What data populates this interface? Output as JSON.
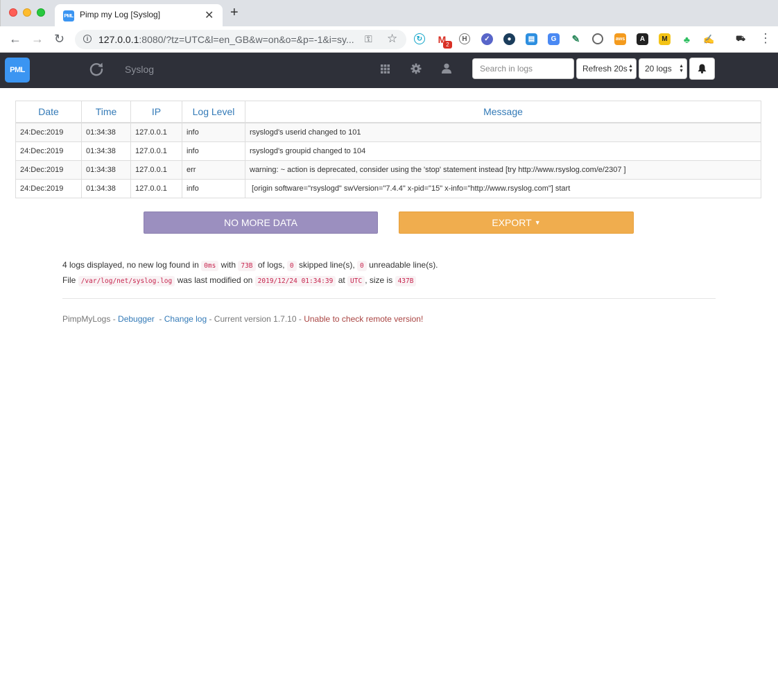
{
  "browser": {
    "tab_title": "Pimp my Log [Syslog]",
    "favicon_text": "PML",
    "url_host": "127.0.0.1",
    "url_rest": ":8080/?tz=UTC&l=en_GB&w=on&o=&p=-1&i=sy...",
    "extension_badge": "2",
    "icons": [
      "back-icon",
      "forward-icon",
      "reload-icon",
      "info-icon",
      "key-icon",
      "star-icon",
      "menu-icon"
    ]
  },
  "navbar": {
    "logo_text": "PML",
    "title": "Syslog",
    "search_placeholder": "Search in logs",
    "refresh_label": "Refresh 20s",
    "logs_count_label": "20 logs",
    "bg_color": "#2e3039"
  },
  "table": {
    "headers": [
      "Date",
      "Time",
      "IP",
      "Log Level",
      "Message"
    ],
    "rows": [
      [
        "24:Dec:2019",
        "01:34:38",
        "127.0.0.1",
        "info",
        "rsyslogd's userid changed to 101"
      ],
      [
        "24:Dec:2019",
        "01:34:38",
        "127.0.0.1",
        "info",
        "rsyslogd's groupid changed to 104"
      ],
      [
        "24:Dec:2019",
        "01:34:38",
        "127.0.0.1",
        "err",
        "warning: ~ action is deprecated, consider using the 'stop' statement instead [try http://www.rsyslog.com/e/2307 ]"
      ],
      [
        "24:Dec:2019",
        "01:34:38",
        "127.0.0.1",
        "info",
        " [origin software=\"rsyslogd\" swVersion=\"7.4.4\" x-pid=\"15\" x-info=\"http://www.rsyslog.com\"] start"
      ]
    ]
  },
  "buttons": {
    "no_more_data": "NO MORE DATA",
    "export": "EXPORT",
    "no_more_color": "#9b8fbf",
    "export_color": "#f0ad4e"
  },
  "info": {
    "line1_a": "4 logs displayed, no new log found in",
    "time": "0ms",
    "line1_b": "with",
    "bytes": "73B",
    "line1_c": "of logs,",
    "skipped": "0",
    "line1_d": "skipped line(s),",
    "unreadable": "0",
    "line1_e": "unreadable line(s).",
    "line2_a": "File",
    "file_path": "/var/log/net/syslog.log",
    "line2_b": "was last modified on",
    "modified": "2019/12/24 01:34:39",
    "line2_c": "at",
    "timezone": "UTC",
    "line2_d": ", size is",
    "size": "437B"
  },
  "footer": {
    "brand": "PimpMyLogs",
    "sep1": " - ",
    "debugger": "Debugger",
    "sep2": "  - ",
    "changelog": "Change log",
    "version_text": " - Current version 1.7.10 - ",
    "remote_warning": "Unable to check remote version!"
  }
}
